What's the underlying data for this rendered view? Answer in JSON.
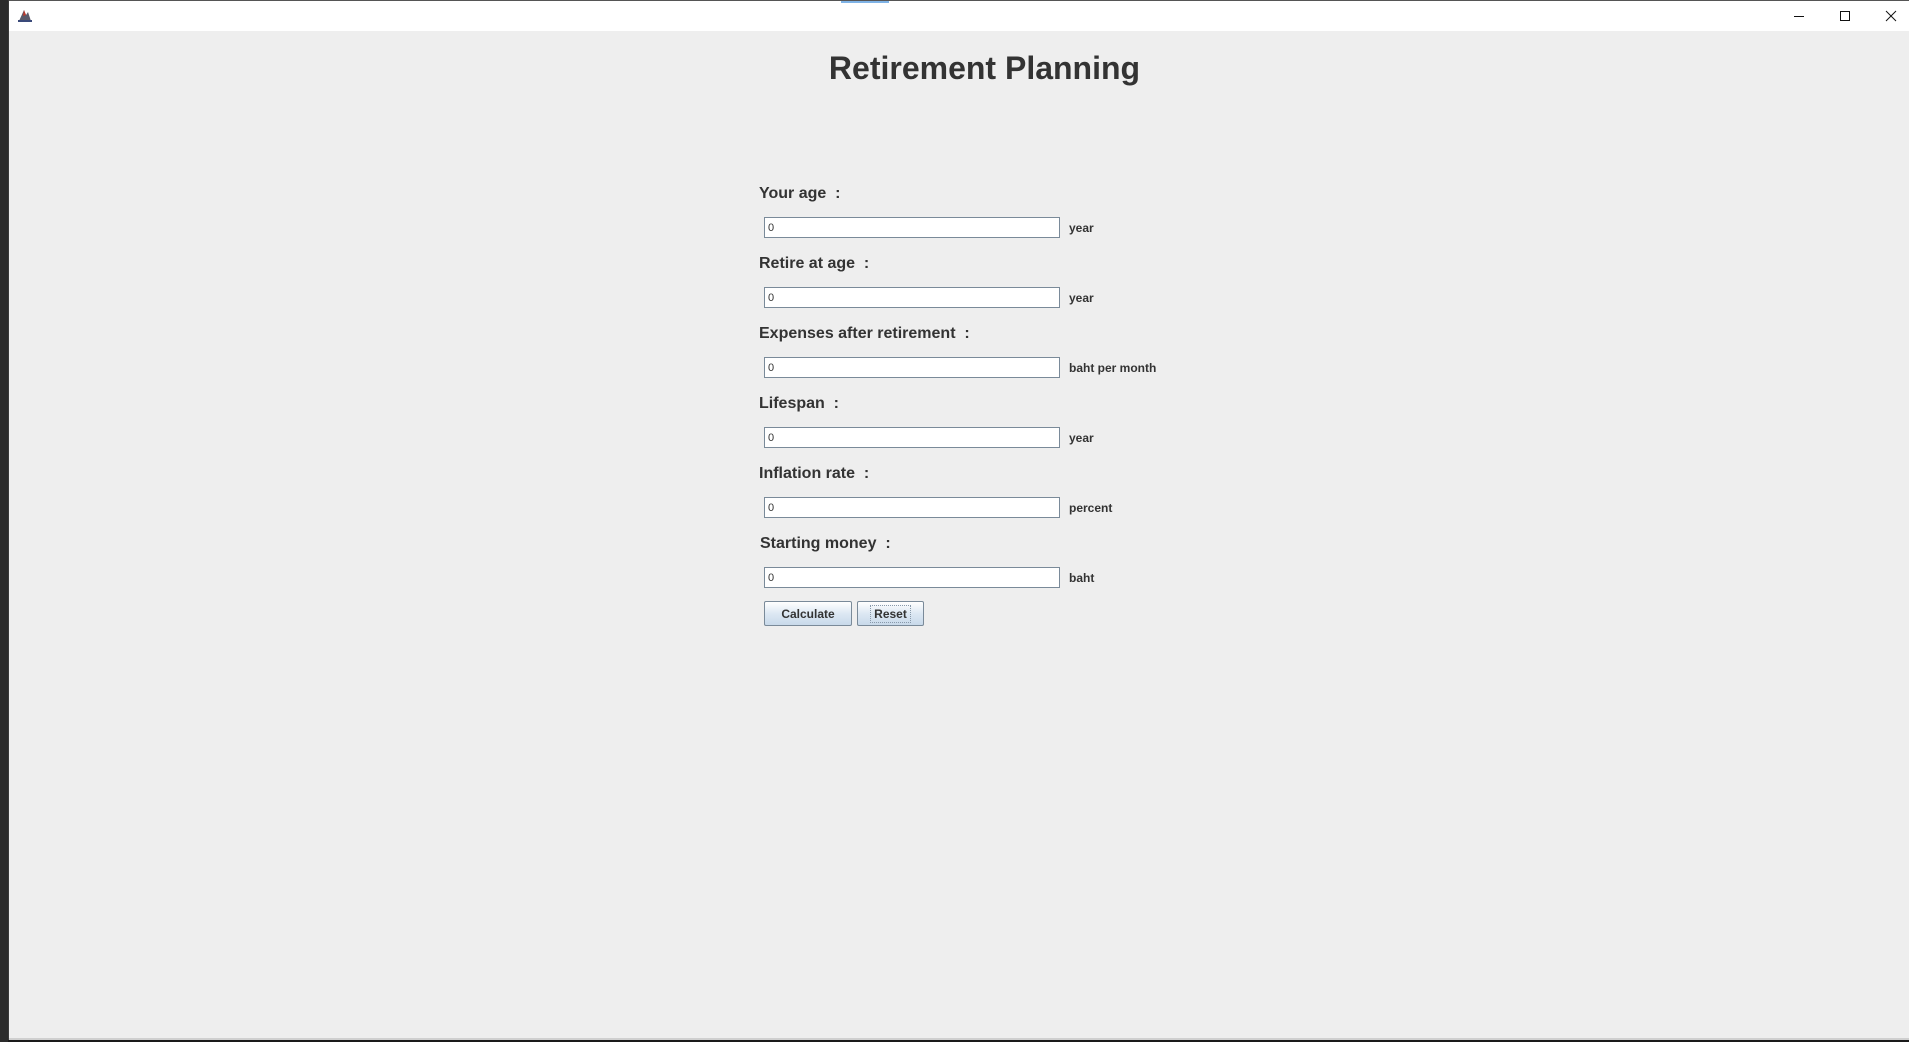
{
  "window": {
    "title_icon": "java-app-icon",
    "controls": {
      "minimize": "minimize-icon",
      "maximize": "maximize-icon",
      "close": "close-icon"
    }
  },
  "page_title": "Retirement Planning",
  "fields": [
    {
      "label": "Your age  :",
      "value": "0",
      "unit": "year"
    },
    {
      "label": "Retire at age  :",
      "value": "0",
      "unit": "year"
    },
    {
      "label": "Expenses after retirement  :",
      "value": "0",
      "unit": "baht per month"
    },
    {
      "label": "Lifespan  :",
      "value": "0",
      "unit": "year"
    },
    {
      "label": "Inflation rate  :",
      "value": "0",
      "unit": "percent"
    },
    {
      "label": "Starting money  :",
      "value": "0",
      "unit": "baht"
    }
  ],
  "buttons": {
    "calculate": "Calculate",
    "reset": "Reset"
  },
  "colors": {
    "background": "#eeeeee",
    "text": "#333333",
    "accent": "#7fb3e6"
  }
}
